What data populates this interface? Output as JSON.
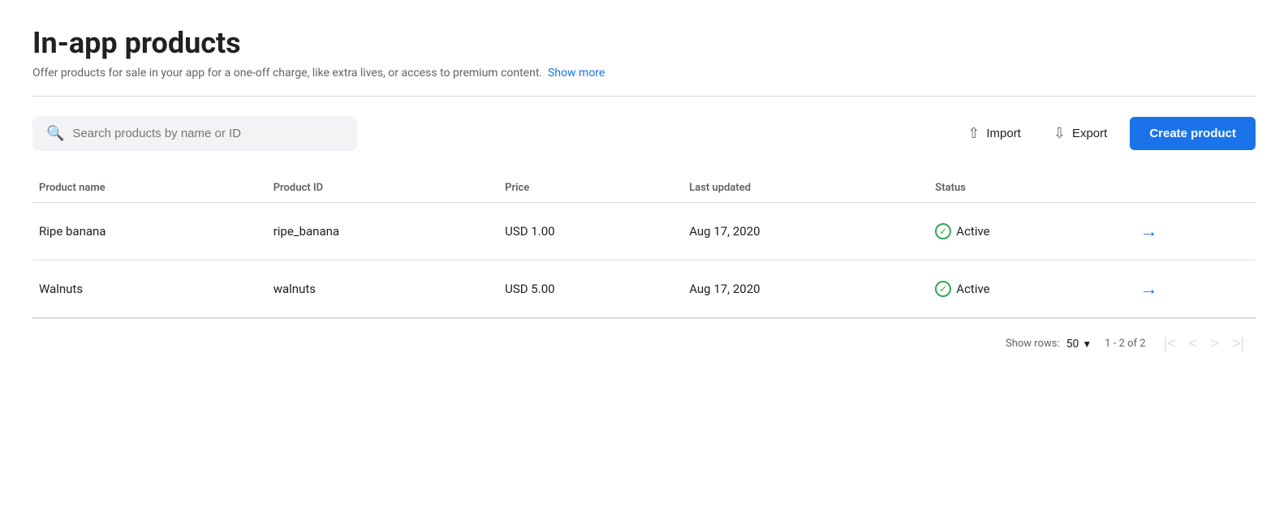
{
  "page": {
    "title": "In-app products",
    "subtitle": "Offer products for sale in your app for a one-off charge, like extra lives, or access to premium content.",
    "show_more_label": "Show more"
  },
  "toolbar": {
    "search_placeholder": "Search products by name or ID",
    "import_label": "Import",
    "export_label": "Export",
    "create_label": "Create product"
  },
  "table": {
    "columns": [
      {
        "key": "name",
        "label": "Product name"
      },
      {
        "key": "id",
        "label": "Product ID"
      },
      {
        "key": "price",
        "label": "Price"
      },
      {
        "key": "updated",
        "label": "Last updated"
      },
      {
        "key": "status",
        "label": "Status"
      }
    ],
    "rows": [
      {
        "name": "Ripe banana",
        "id": "ripe_banana",
        "price": "USD 1.00",
        "updated": "Aug 17, 2020",
        "status": "Active"
      },
      {
        "name": "Walnuts",
        "id": "walnuts",
        "price": "USD 5.00",
        "updated": "Aug 17, 2020",
        "status": "Active"
      }
    ]
  },
  "pagination": {
    "show_rows_label": "Show rows:",
    "rows_per_page": "50",
    "page_info": "1 - 2 of 2"
  }
}
